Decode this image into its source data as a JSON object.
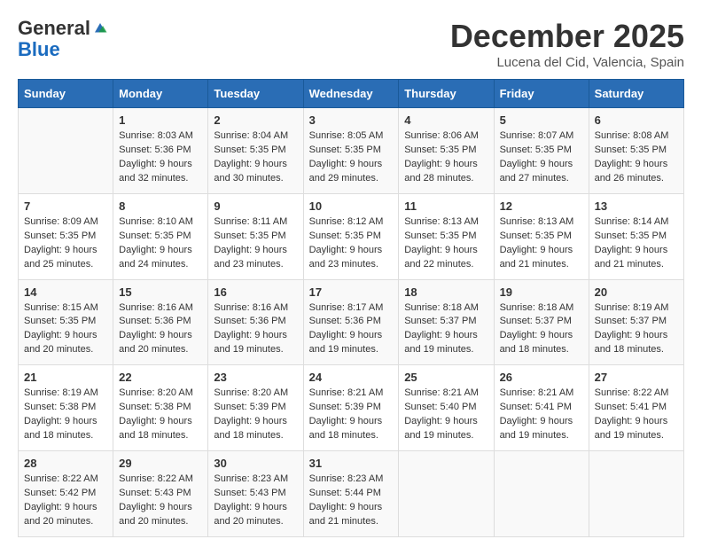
{
  "header": {
    "logo_line1": "General",
    "logo_line2": "Blue",
    "month_title": "December 2025",
    "location": "Lucena del Cid, Valencia, Spain"
  },
  "weekdays": [
    "Sunday",
    "Monday",
    "Tuesday",
    "Wednesday",
    "Thursday",
    "Friday",
    "Saturday"
  ],
  "weeks": [
    [
      {
        "day": "",
        "info": ""
      },
      {
        "day": "1",
        "info": "Sunrise: 8:03 AM\nSunset: 5:36 PM\nDaylight: 9 hours\nand 32 minutes."
      },
      {
        "day": "2",
        "info": "Sunrise: 8:04 AM\nSunset: 5:35 PM\nDaylight: 9 hours\nand 30 minutes."
      },
      {
        "day": "3",
        "info": "Sunrise: 8:05 AM\nSunset: 5:35 PM\nDaylight: 9 hours\nand 29 minutes."
      },
      {
        "day": "4",
        "info": "Sunrise: 8:06 AM\nSunset: 5:35 PM\nDaylight: 9 hours\nand 28 minutes."
      },
      {
        "day": "5",
        "info": "Sunrise: 8:07 AM\nSunset: 5:35 PM\nDaylight: 9 hours\nand 27 minutes."
      },
      {
        "day": "6",
        "info": "Sunrise: 8:08 AM\nSunset: 5:35 PM\nDaylight: 9 hours\nand 26 minutes."
      }
    ],
    [
      {
        "day": "7",
        "info": "Sunrise: 8:09 AM\nSunset: 5:35 PM\nDaylight: 9 hours\nand 25 minutes."
      },
      {
        "day": "8",
        "info": "Sunrise: 8:10 AM\nSunset: 5:35 PM\nDaylight: 9 hours\nand 24 minutes."
      },
      {
        "day": "9",
        "info": "Sunrise: 8:11 AM\nSunset: 5:35 PM\nDaylight: 9 hours\nand 23 minutes."
      },
      {
        "day": "10",
        "info": "Sunrise: 8:12 AM\nSunset: 5:35 PM\nDaylight: 9 hours\nand 23 minutes."
      },
      {
        "day": "11",
        "info": "Sunrise: 8:13 AM\nSunset: 5:35 PM\nDaylight: 9 hours\nand 22 minutes."
      },
      {
        "day": "12",
        "info": "Sunrise: 8:13 AM\nSunset: 5:35 PM\nDaylight: 9 hours\nand 21 minutes."
      },
      {
        "day": "13",
        "info": "Sunrise: 8:14 AM\nSunset: 5:35 PM\nDaylight: 9 hours\nand 21 minutes."
      }
    ],
    [
      {
        "day": "14",
        "info": "Sunrise: 8:15 AM\nSunset: 5:35 PM\nDaylight: 9 hours\nand 20 minutes."
      },
      {
        "day": "15",
        "info": "Sunrise: 8:16 AM\nSunset: 5:36 PM\nDaylight: 9 hours\nand 20 minutes."
      },
      {
        "day": "16",
        "info": "Sunrise: 8:16 AM\nSunset: 5:36 PM\nDaylight: 9 hours\nand 19 minutes."
      },
      {
        "day": "17",
        "info": "Sunrise: 8:17 AM\nSunset: 5:36 PM\nDaylight: 9 hours\nand 19 minutes."
      },
      {
        "day": "18",
        "info": "Sunrise: 8:18 AM\nSunset: 5:37 PM\nDaylight: 9 hours\nand 19 minutes."
      },
      {
        "day": "19",
        "info": "Sunrise: 8:18 AM\nSunset: 5:37 PM\nDaylight: 9 hours\nand 18 minutes."
      },
      {
        "day": "20",
        "info": "Sunrise: 8:19 AM\nSunset: 5:37 PM\nDaylight: 9 hours\nand 18 minutes."
      }
    ],
    [
      {
        "day": "21",
        "info": "Sunrise: 8:19 AM\nSunset: 5:38 PM\nDaylight: 9 hours\nand 18 minutes."
      },
      {
        "day": "22",
        "info": "Sunrise: 8:20 AM\nSunset: 5:38 PM\nDaylight: 9 hours\nand 18 minutes."
      },
      {
        "day": "23",
        "info": "Sunrise: 8:20 AM\nSunset: 5:39 PM\nDaylight: 9 hours\nand 18 minutes."
      },
      {
        "day": "24",
        "info": "Sunrise: 8:21 AM\nSunset: 5:39 PM\nDaylight: 9 hours\nand 18 minutes."
      },
      {
        "day": "25",
        "info": "Sunrise: 8:21 AM\nSunset: 5:40 PM\nDaylight: 9 hours\nand 19 minutes."
      },
      {
        "day": "26",
        "info": "Sunrise: 8:21 AM\nSunset: 5:41 PM\nDaylight: 9 hours\nand 19 minutes."
      },
      {
        "day": "27",
        "info": "Sunrise: 8:22 AM\nSunset: 5:41 PM\nDaylight: 9 hours\nand 19 minutes."
      }
    ],
    [
      {
        "day": "28",
        "info": "Sunrise: 8:22 AM\nSunset: 5:42 PM\nDaylight: 9 hours\nand 20 minutes."
      },
      {
        "day": "29",
        "info": "Sunrise: 8:22 AM\nSunset: 5:43 PM\nDaylight: 9 hours\nand 20 minutes."
      },
      {
        "day": "30",
        "info": "Sunrise: 8:23 AM\nSunset: 5:43 PM\nDaylight: 9 hours\nand 20 minutes."
      },
      {
        "day": "31",
        "info": "Sunrise: 8:23 AM\nSunset: 5:44 PM\nDaylight: 9 hours\nand 21 minutes."
      },
      {
        "day": "",
        "info": ""
      },
      {
        "day": "",
        "info": ""
      },
      {
        "day": "",
        "info": ""
      }
    ]
  ]
}
